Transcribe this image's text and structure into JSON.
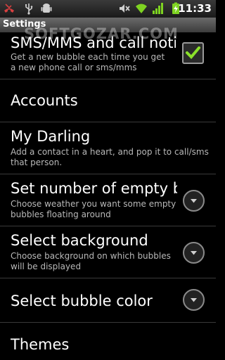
{
  "status_bar": {
    "time": "11:33",
    "icons": [
      "missed-call-icon",
      "usb-icon",
      "android-debug-icon",
      "mute-icon",
      "wifi-icon",
      "signal-icon",
      "battery-charging-icon"
    ]
  },
  "titlebar": {
    "title": "Settings"
  },
  "watermark": "SOFTGOZAR.COM",
  "items": [
    {
      "title": "SMS/MMS and call notifie",
      "summary": "Get a new bubble each time you get a new phone call or sms/mms",
      "checked": true
    },
    {
      "title": "Accounts"
    },
    {
      "title": "My Darling",
      "summary": "Add a contact in a heart, and pop it to call/sms that person."
    },
    {
      "title": "Set number of empty bub",
      "summary": "Choose weather you want some empty bubbles floating around"
    },
    {
      "title": "Select background",
      "summary": "Choose background on which bubbles will be displayed"
    },
    {
      "title": "Select bubble color"
    },
    {
      "title": "Themes"
    }
  ]
}
